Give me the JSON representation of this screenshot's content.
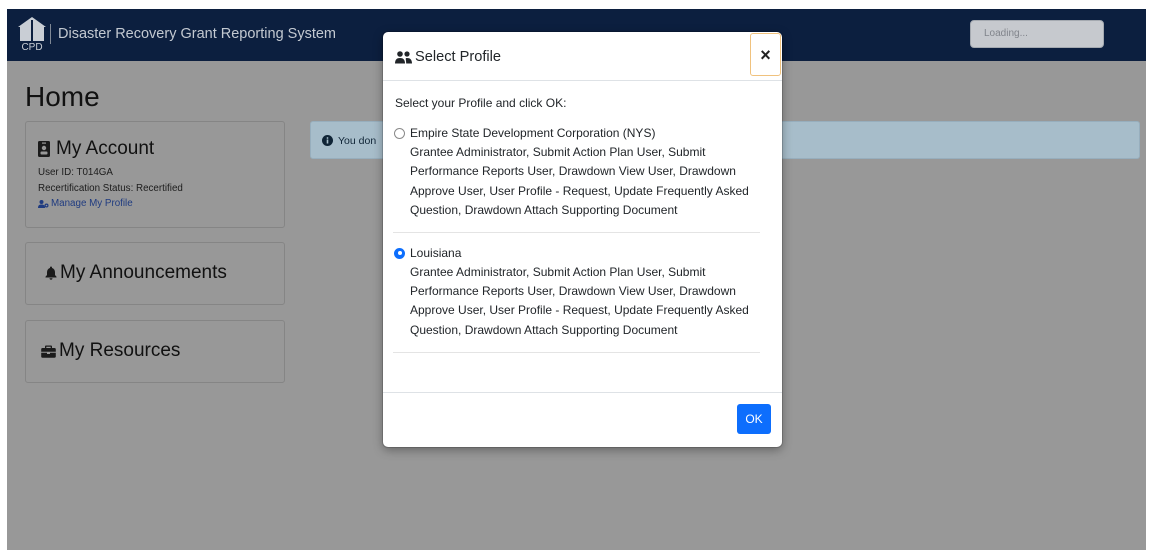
{
  "colors": {
    "navbar_bg": "#0c1f3f",
    "accent": "#0d6efd",
    "link": "#1f3b80",
    "alert_bg": "#a7bdca",
    "page_bg": "#989898"
  },
  "navbar": {
    "logo": {
      "icon": "cpd-logo-icon",
      "text": "CPD"
    },
    "app_title": "Disaster Recovery Grant Reporting System",
    "profile_select": {
      "value": "Loading..."
    }
  },
  "page": {
    "title": "Home"
  },
  "sidebar": {
    "account": {
      "icon": "id-badge-icon",
      "title": "My Account",
      "user_id": "User ID: T014GA",
      "recertification_status": "Recertification Status: Recertified",
      "manage_profile": {
        "icon": "user-cog-icon",
        "label": "Manage My Profile"
      }
    },
    "announcements": {
      "icon": "bell-icon",
      "title": "My Announcements"
    },
    "resources": {
      "icon": "briefcase-icon",
      "title": "My Resources"
    }
  },
  "alert": {
    "icon": "info-circle-icon",
    "text": "You don"
  },
  "modal": {
    "icon": "users-icon",
    "title": "Select Profile",
    "close_label": "×",
    "instruction": "Select your Profile and click OK:",
    "profiles": [
      {
        "name": "Empire State Development Corporation (NYS)",
        "roles": "Grantee Administrator, Submit Action Plan User, Submit Performance Reports User, Drawdown View User, Drawdown Approve User, User Profile - Request, Update Frequently Asked Question, Drawdown Attach Supporting Document",
        "selected": false
      },
      {
        "name": "Louisiana",
        "roles": "Grantee Administrator, Submit Action Plan User, Submit Performance Reports User, Drawdown View User, Drawdown Approve User, User Profile - Request, Update Frequently Asked Question, Drawdown Attach Supporting Document",
        "selected": true
      }
    ],
    "ok_label": "OK"
  }
}
